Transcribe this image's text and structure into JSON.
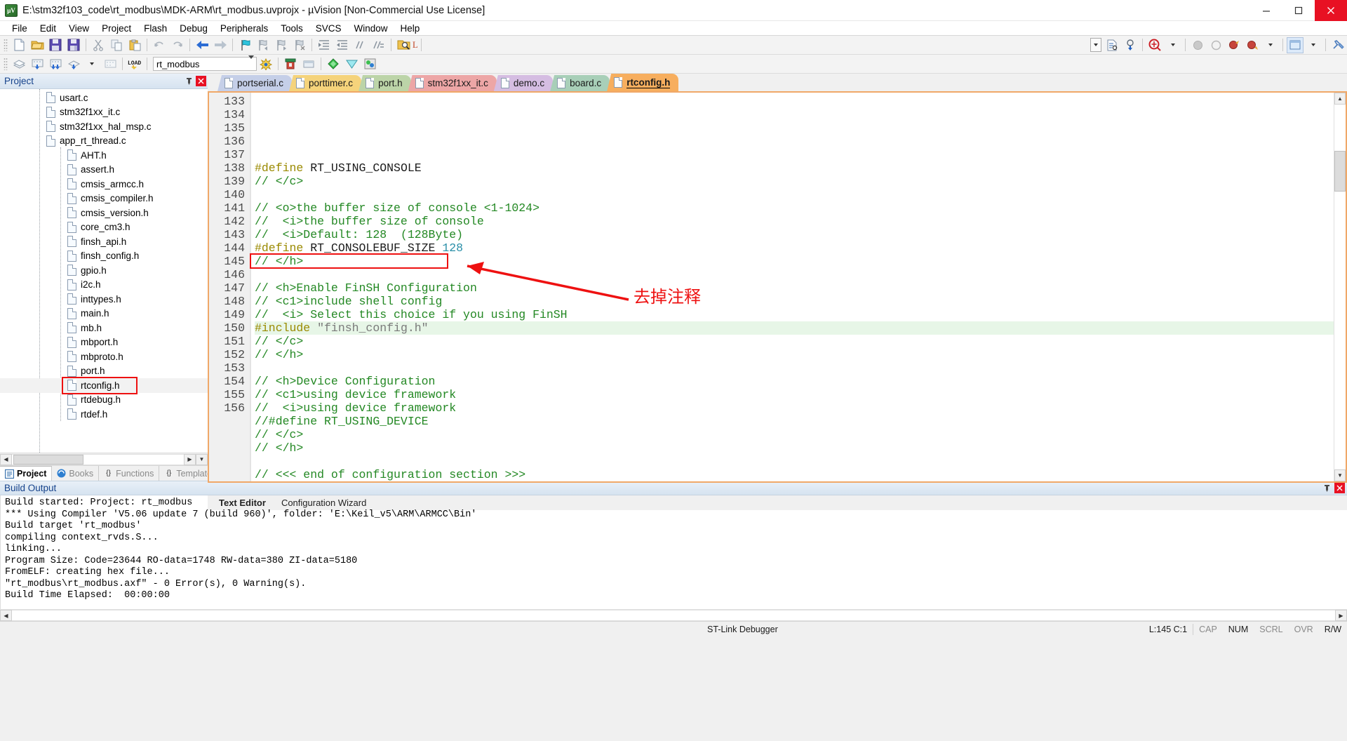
{
  "window": {
    "title": "E:\\stm32f103_code\\rt_modbus\\MDK-ARM\\rt_modbus.uvprojx - µVision  [Non-Commercial Use License]",
    "app_icon": "uvision-icon",
    "minimize": "minimize-button",
    "maximize": "maximize-button",
    "close": "close-button"
  },
  "menubar": {
    "items": [
      "File",
      "Edit",
      "View",
      "Project",
      "Flash",
      "Debug",
      "Peripherals",
      "Tools",
      "SVCS",
      "Window",
      "Help"
    ]
  },
  "toolbar1": {
    "load_label": "L",
    "target_placeholder": ""
  },
  "toolbar2": {
    "project_target": "rt_modbus",
    "load_label": "LOAD"
  },
  "project_pane": {
    "header": "Project",
    "tree": [
      {
        "label": "usart.c",
        "indent": 1,
        "expander": "+",
        "selected": false
      },
      {
        "label": "stm32f1xx_it.c",
        "indent": 1,
        "expander": "+",
        "selected": false
      },
      {
        "label": "stm32f1xx_hal_msp.c",
        "indent": 1,
        "expander": "+",
        "selected": false
      },
      {
        "label": "app_rt_thread.c",
        "indent": 1,
        "expander": "-",
        "selected": false
      },
      {
        "label": "AHT.h",
        "indent": 2,
        "expander": "",
        "selected": false
      },
      {
        "label": "assert.h",
        "indent": 2,
        "expander": "",
        "selected": false
      },
      {
        "label": "cmsis_armcc.h",
        "indent": 2,
        "expander": "",
        "selected": false
      },
      {
        "label": "cmsis_compiler.h",
        "indent": 2,
        "expander": "",
        "selected": false
      },
      {
        "label": "cmsis_version.h",
        "indent": 2,
        "expander": "",
        "selected": false
      },
      {
        "label": "core_cm3.h",
        "indent": 2,
        "expander": "",
        "selected": false
      },
      {
        "label": "finsh_api.h",
        "indent": 2,
        "expander": "",
        "selected": false
      },
      {
        "label": "finsh_config.h",
        "indent": 2,
        "expander": "",
        "selected": false
      },
      {
        "label": "gpio.h",
        "indent": 2,
        "expander": "",
        "selected": false
      },
      {
        "label": "i2c.h",
        "indent": 2,
        "expander": "",
        "selected": false
      },
      {
        "label": "inttypes.h",
        "indent": 2,
        "expander": "",
        "selected": false
      },
      {
        "label": "main.h",
        "indent": 2,
        "expander": "",
        "selected": false
      },
      {
        "label": "mb.h",
        "indent": 2,
        "expander": "",
        "selected": false
      },
      {
        "label": "mbport.h",
        "indent": 2,
        "expander": "",
        "selected": false
      },
      {
        "label": "mbproto.h",
        "indent": 2,
        "expander": "",
        "selected": false
      },
      {
        "label": "port.h",
        "indent": 2,
        "expander": "",
        "selected": false
      },
      {
        "label": "rtconfig.h",
        "indent": 2,
        "expander": "",
        "selected": true
      },
      {
        "label": "rtdebug.h",
        "indent": 2,
        "expander": "",
        "selected": false
      },
      {
        "label": "rtdef.h",
        "indent": 2,
        "expander": "",
        "selected": false
      }
    ],
    "tabs": [
      {
        "label": "Project",
        "icon": "project-icon",
        "selected": true
      },
      {
        "label": "Books",
        "icon": "books-icon",
        "selected": false
      },
      {
        "label": "Functions",
        "icon": "braces-icon",
        "selected": false
      },
      {
        "label": "Templates",
        "icon": "template-icon",
        "selected": false
      }
    ]
  },
  "editor": {
    "tabs": [
      {
        "label": "portserial.c",
        "color": "#c5cfe8",
        "selected": false
      },
      {
        "label": "porttimer.c",
        "color": "#f5d37b",
        "selected": false
      },
      {
        "label": "port.h",
        "color": "#bcd4a8",
        "selected": false
      },
      {
        "label": "stm32f1xx_it.c",
        "color": "#eda6a6",
        "selected": false
      },
      {
        "label": "demo.c",
        "color": "#d5bde2",
        "selected": false
      },
      {
        "label": "board.c",
        "color": "#a8cfb8",
        "selected": false
      },
      {
        "label": "rtconfig.h",
        "color": "#f7ae5e",
        "selected": true
      }
    ],
    "bottom_tabs": [
      {
        "label": "Text Editor",
        "selected": true
      },
      {
        "label": "Configuration Wizard",
        "selected": false
      }
    ],
    "first_line_number": 133,
    "highlighted_line": 145,
    "annotation": "去掉注释",
    "annotation_color": "#ee1111",
    "lines": [
      {
        "n": 133,
        "tokens": [
          {
            "t": "#define ",
            "c": "pp"
          },
          {
            "t": "RT_USING_CONSOLE",
            "c": "id"
          }
        ]
      },
      {
        "n": 134,
        "tokens": [
          {
            "t": "// </c>",
            "c": "cm"
          }
        ]
      },
      {
        "n": 135,
        "tokens": []
      },
      {
        "n": 136,
        "tokens": [
          {
            "t": "// <o>the buffer size of console <1-1024>",
            "c": "cm"
          }
        ]
      },
      {
        "n": 137,
        "tokens": [
          {
            "t": "//  <i>the buffer size of console",
            "c": "cm"
          }
        ]
      },
      {
        "n": 138,
        "tokens": [
          {
            "t": "//  <i>Default: 128  (128Byte)",
            "c": "cm"
          }
        ]
      },
      {
        "n": 139,
        "tokens": [
          {
            "t": "#define ",
            "c": "pp"
          },
          {
            "t": "RT_CONSOLEBUF_SIZE ",
            "c": "id"
          },
          {
            "t": "128",
            "c": "num"
          }
        ]
      },
      {
        "n": 140,
        "tokens": [
          {
            "t": "// </h>",
            "c": "cm"
          }
        ]
      },
      {
        "n": 141,
        "tokens": []
      },
      {
        "n": 142,
        "tokens": [
          {
            "t": "// <h>Enable FinSH Configuration",
            "c": "cm"
          }
        ]
      },
      {
        "n": 143,
        "tokens": [
          {
            "t": "// <c1>include shell config",
            "c": "cm"
          }
        ]
      },
      {
        "n": 144,
        "tokens": [
          {
            "t": "//  <i> Select this choice if you using FinSH",
            "c": "cm"
          }
        ]
      },
      {
        "n": 145,
        "tokens": [
          {
            "t": "#include ",
            "c": "pp"
          },
          {
            "t": "\"finsh_config.h\"",
            "c": "str"
          }
        ]
      },
      {
        "n": 146,
        "tokens": [
          {
            "t": "// </c>",
            "c": "cm"
          }
        ]
      },
      {
        "n": 147,
        "tokens": [
          {
            "t": "// </h>",
            "c": "cm"
          }
        ]
      },
      {
        "n": 148,
        "tokens": []
      },
      {
        "n": 149,
        "tokens": [
          {
            "t": "// <h>Device Configuration",
            "c": "cm"
          }
        ]
      },
      {
        "n": 150,
        "tokens": [
          {
            "t": "// <c1>using device framework",
            "c": "cm"
          }
        ]
      },
      {
        "n": 151,
        "tokens": [
          {
            "t": "//  <i>using device framework",
            "c": "cm"
          }
        ]
      },
      {
        "n": 152,
        "tokens": [
          {
            "t": "//#define RT_USING_DEVICE",
            "c": "cm"
          }
        ]
      },
      {
        "n": 153,
        "tokens": [
          {
            "t": "// </c>",
            "c": "cm"
          }
        ]
      },
      {
        "n": 154,
        "tokens": [
          {
            "t": "// </h>",
            "c": "cm"
          }
        ]
      },
      {
        "n": 155,
        "tokens": []
      },
      {
        "n": 156,
        "tokens": [
          {
            "t": "// <<< end of configuration section >>>",
            "c": "cm"
          }
        ]
      }
    ]
  },
  "build_output": {
    "header": "Build Output",
    "text": "Build started: Project: rt_modbus\n*** Using Compiler 'V5.06 update 7 (build 960)', folder: 'E:\\Keil_v5\\ARM\\ARMCC\\Bin'\nBuild target 'rt_modbus'\ncompiling context_rvds.S...\nlinking...\nProgram Size: Code=23644 RO-data=1748 RW-data=380 ZI-data=5180\nFromELF: creating hex file...\n\"rt_modbus\\rt_modbus.axf\" - 0 Error(s), 0 Warning(s).\nBuild Time Elapsed:  00:00:00"
  },
  "statusbar": {
    "debugger": "ST-Link Debugger",
    "cursor": "L:145 C:1",
    "indicators": [
      "CAP",
      "NUM",
      "SCRL",
      "OVR",
      "R/W"
    ],
    "active_indicator": "NUM"
  }
}
